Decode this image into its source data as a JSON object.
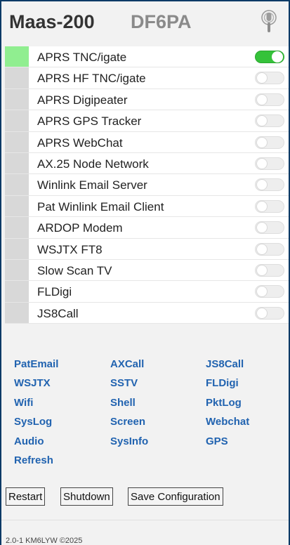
{
  "header": {
    "title": "Maas-200",
    "callsign": "DF6PA",
    "podcast_icon": "podcast-icon"
  },
  "services": [
    {
      "label": "APRS TNC/igate",
      "enabled": true
    },
    {
      "label": "APRS HF TNC/igate",
      "enabled": false
    },
    {
      "label": "APRS Digipeater",
      "enabled": false
    },
    {
      "label": "APRS GPS Tracker",
      "enabled": false
    },
    {
      "label": "APRS WebChat",
      "enabled": false
    },
    {
      "label": "AX.25 Node Network",
      "enabled": false
    },
    {
      "label": "Winlink Email Server",
      "enabled": false
    },
    {
      "label": "Pat Winlink Email Client",
      "enabled": false
    },
    {
      "label": "ARDOP Modem",
      "enabled": false
    },
    {
      "label": "WSJTX FT8",
      "enabled": false
    },
    {
      "label": "Slow Scan TV",
      "enabled": false
    },
    {
      "label": "FLDigi",
      "enabled": false
    },
    {
      "label": "JS8Call",
      "enabled": false
    }
  ],
  "links": [
    [
      "PatEmail",
      "AXCall",
      "JS8Call"
    ],
    [
      "WSJTX",
      "SSTV",
      "FLDigi"
    ],
    [
      "Wifi",
      "Shell",
      "PktLog"
    ],
    [
      "SysLog",
      "Screen",
      "Webchat"
    ],
    [
      "Audio",
      "SysInfo",
      "GPS"
    ],
    [
      "Refresh"
    ]
  ],
  "buttons": {
    "restart": "Restart",
    "shutdown": "Shutdown",
    "save": "Save Configuration"
  },
  "footer": "2.0-1 KM6LYW ©2025",
  "colors": {
    "accent_link": "#2163b0",
    "toggle_on": "#35c23a",
    "status_on": "#90ee90",
    "status_off": "#d8d8d8",
    "frame_border": "#0b3a66"
  }
}
